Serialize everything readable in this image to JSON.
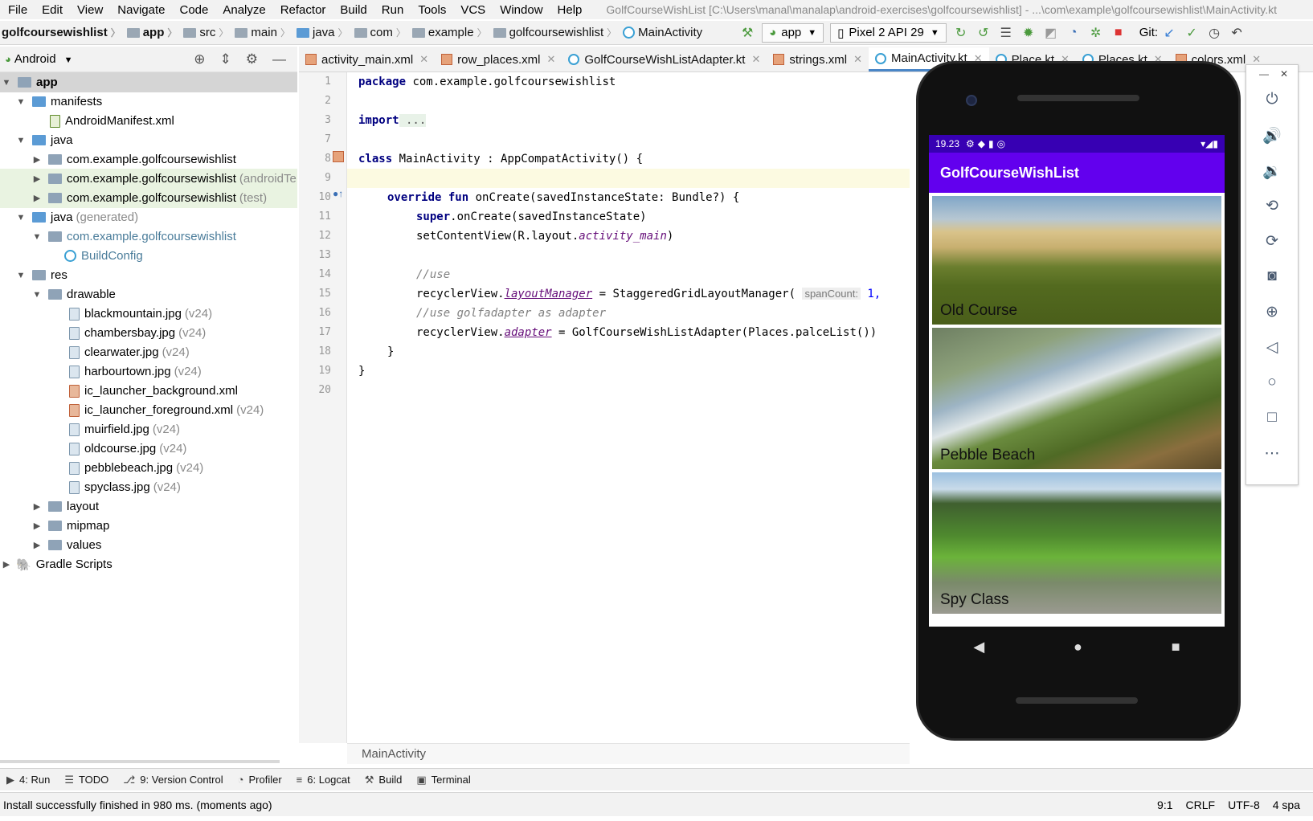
{
  "menu": {
    "items": [
      "File",
      "Edit",
      "View",
      "Navigate",
      "Code",
      "Analyze",
      "Refactor",
      "Build",
      "Run",
      "Tools",
      "VCS",
      "Window",
      "Help"
    ],
    "title": "GolfCourseWishList [C:\\Users\\manal\\manalap\\android-exercises\\golfcoursewishlist] - ...\\com\\example\\golfcoursewishlist\\MainActivity.kt"
  },
  "breadcrumb": {
    "root": "golfcoursewishlist",
    "items": [
      "app",
      "src",
      "main",
      "java",
      "com",
      "example",
      "golfcoursewishlist",
      "MainActivity"
    ]
  },
  "toolbar": {
    "run_config": "app",
    "device": "Pixel 2 API 29",
    "git_label": "Git:"
  },
  "project": {
    "view": "Android",
    "tree": [
      {
        "label": "app",
        "suffix": ""
      },
      {
        "label": "manifests",
        "suffix": ""
      },
      {
        "label": "AndroidManifest.xml",
        "suffix": ""
      },
      {
        "label": "java",
        "suffix": ""
      },
      {
        "label": "com.example.golfcoursewishlist",
        "suffix": ""
      },
      {
        "label": "com.example.golfcoursewishlist",
        "suffix": "(androidTe"
      },
      {
        "label": "com.example.golfcoursewishlist",
        "suffix": "(test)"
      },
      {
        "label": "java",
        "suffix": "(generated)"
      },
      {
        "label": "com.example.golfcoursewishlist",
        "suffix": ""
      },
      {
        "label": "BuildConfig",
        "suffix": ""
      },
      {
        "label": "res",
        "suffix": ""
      },
      {
        "label": "drawable",
        "suffix": ""
      },
      {
        "label": "blackmountain.jpg",
        "suffix": "(v24)"
      },
      {
        "label": "chambersbay.jpg",
        "suffix": "(v24)"
      },
      {
        "label": "clearwater.jpg",
        "suffix": "(v24)"
      },
      {
        "label": "harbourtown.jpg",
        "suffix": "(v24)"
      },
      {
        "label": "ic_launcher_background.xml",
        "suffix": ""
      },
      {
        "label": "ic_launcher_foreground.xml",
        "suffix": "(v24)"
      },
      {
        "label": "muirfield.jpg",
        "suffix": "(v24)"
      },
      {
        "label": "oldcourse.jpg",
        "suffix": "(v24)"
      },
      {
        "label": "pebblebeach.jpg",
        "suffix": "(v24)"
      },
      {
        "label": "spyclass.jpg",
        "suffix": "(v24)"
      },
      {
        "label": "layout",
        "suffix": ""
      },
      {
        "label": "mipmap",
        "suffix": ""
      },
      {
        "label": "values",
        "suffix": ""
      },
      {
        "label": "Gradle Scripts",
        "suffix": ""
      }
    ]
  },
  "tabs": [
    "activity_main.xml",
    "row_places.xml",
    "GolfCourseWishListAdapter.kt",
    "strings.xml",
    "MainActivity.kt",
    "Place.kt",
    "Places.kt",
    "colors.xml"
  ],
  "editor": {
    "line_numbers": [
      "1",
      "2",
      "3",
      "7",
      "8",
      "9",
      "10",
      "11",
      "12",
      "13",
      "14",
      "15",
      "16",
      "17",
      "18",
      "19",
      "20"
    ],
    "code": {
      "l1_kw": "package",
      "l1_rest": " com.example.golfcoursewishlist",
      "l3_kw": "import",
      "l3_rest": " ...",
      "l8_kw": "class",
      "l8_rest": " MainActivity : AppCompatActivity() {",
      "l10_kw": "override fun",
      "l10_rest": " onCreate(savedInstanceState: Bundle?) {",
      "l11_kw": "super",
      "l11_rest": ".onCreate(savedInstanceState)",
      "l12_a": "setContentView(R.layout.",
      "l12_b": "activity_main",
      "l12_c": ")",
      "l14": "//use",
      "l15_a": "recyclerView.",
      "l15_b": "layoutManager",
      "l15_c": " = StaggeredGridLayoutManager( ",
      "l15_hint": "spanCount:",
      "l15_d": " 1,",
      "l16": "//use golfadapter as adapter",
      "l17_a": "recyclerView.",
      "l17_b": "adapter",
      "l17_c": " = GolfCourseWishListAdapter(Places.palceList())",
      "l18": "}",
      "l19": "}"
    },
    "crumb": "MainActivity"
  },
  "bottom_tools": [
    {
      "label": "4: Run",
      "icon": "run-icon"
    },
    {
      "label": "TODO",
      "icon": "list-icon"
    },
    {
      "label": "9: Version Control",
      "icon": "vcs-icon"
    },
    {
      "label": "Profiler",
      "icon": "profiler-icon"
    },
    {
      "label": "6: Logcat",
      "icon": "logcat-icon"
    },
    {
      "label": "Build",
      "icon": "hammer-icon"
    },
    {
      "label": "Terminal",
      "icon": "terminal-icon"
    }
  ],
  "status": {
    "message": "Install successfully finished in 980 ms. (moments ago)",
    "position": "9:1",
    "line_sep": "CRLF",
    "encoding": "UTF-8",
    "indent": "4 spa"
  },
  "emulator": {
    "time": "19.23",
    "app_title": "GolfCourseWishList",
    "places": [
      "Old Course",
      "Pebble Beach",
      "Spy Class"
    ],
    "controls": [
      "power-icon",
      "volume-up-icon",
      "volume-down-icon",
      "rotate-left-icon",
      "rotate-right-icon",
      "camera-icon",
      "zoom-icon",
      "back-icon",
      "home-icon",
      "overview-icon",
      "more-icon"
    ]
  }
}
